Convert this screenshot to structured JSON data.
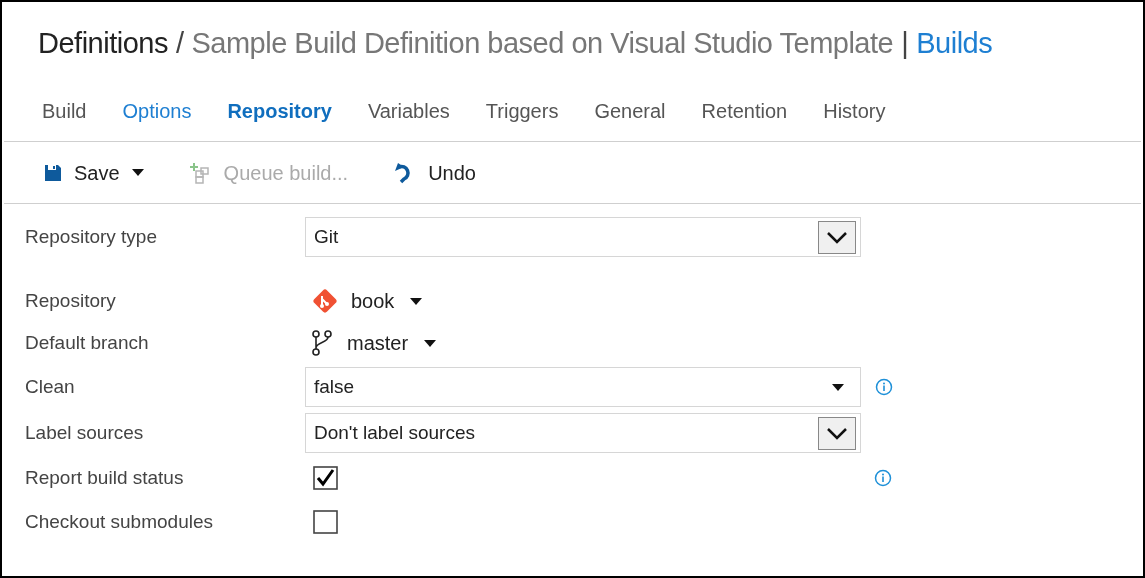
{
  "header": {
    "breadcrumb": "Definitions",
    "separator": "/",
    "title": "Sample Build Definition based on Visual Studio Template",
    "divider": "|",
    "hub": "Builds"
  },
  "tabs": [
    {
      "label": "Build",
      "selected": false,
      "highlighted": false
    },
    {
      "label": "Options",
      "selected": false,
      "highlighted": true
    },
    {
      "label": "Repository",
      "selected": true,
      "highlighted": false
    },
    {
      "label": "Variables",
      "selected": false,
      "highlighted": false
    },
    {
      "label": "Triggers",
      "selected": false,
      "highlighted": false
    },
    {
      "label": "General",
      "selected": false,
      "highlighted": false
    },
    {
      "label": "Retention",
      "selected": false,
      "highlighted": false
    },
    {
      "label": "History",
      "selected": false,
      "highlighted": false
    }
  ],
  "toolbar": [
    {
      "kind": "save",
      "label": "Save",
      "disabled": false
    },
    {
      "kind": "queue",
      "label": "Queue build...",
      "disabled": true
    },
    {
      "kind": "undo",
      "label": "Undo",
      "disabled": false
    }
  ],
  "fields": [
    {
      "label": "Repository type",
      "kind": "select",
      "value": "Git",
      "info": false
    },
    {
      "label": "Repository",
      "kind": "repo",
      "value": "book",
      "info": false
    },
    {
      "label": "Default branch",
      "kind": "branch",
      "value": "master",
      "info": false
    },
    {
      "label": "Clean",
      "kind": "dropdown",
      "value": "false",
      "info": true
    },
    {
      "label": "Label sources",
      "kind": "select",
      "value": "Don't label sources",
      "info": false
    },
    {
      "label": "Report build status",
      "kind": "checkbox",
      "checked": true,
      "info": true
    },
    {
      "label": "Checkout submodules",
      "kind": "checkbox",
      "checked": false,
      "info": false
    }
  ]
}
